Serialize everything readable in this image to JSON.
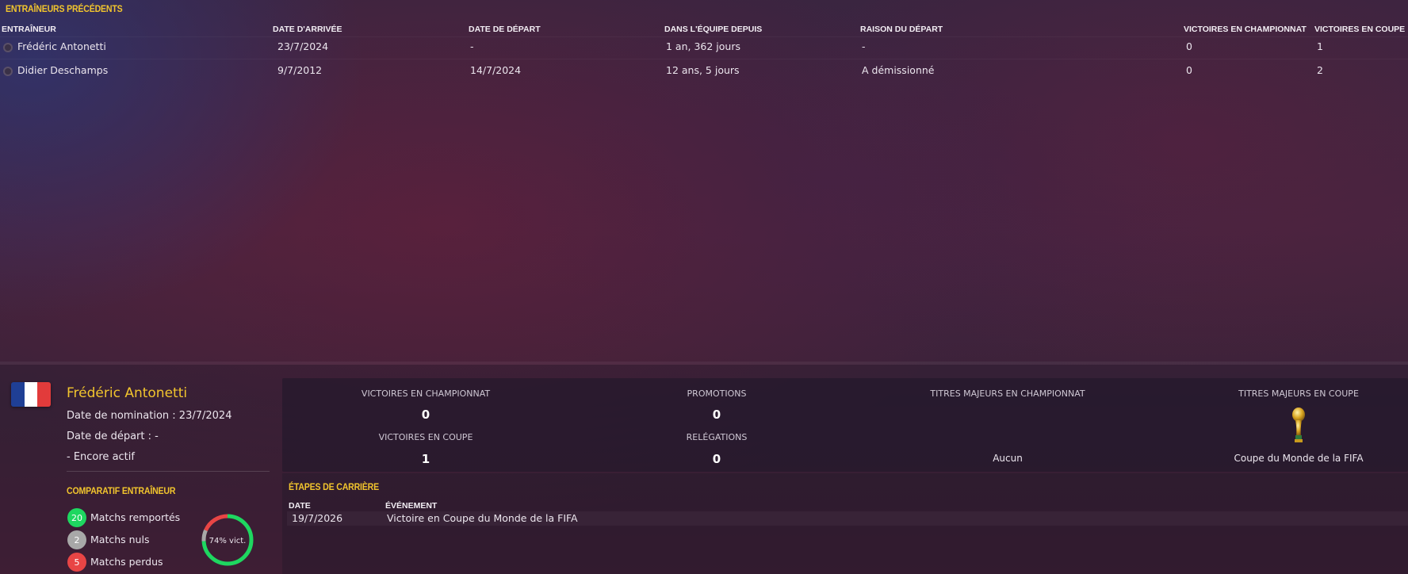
{
  "previous_coaches": {
    "title": "Entraîneurs précédents",
    "columns": [
      "Entraîneur",
      "Date d'arrivée",
      "Date de départ",
      "Dans l'équipe depuis",
      "Raison du départ",
      "Victoires en championnat",
      "Victoires en coupe"
    ],
    "rows": [
      [
        "Frédéric Antonetti",
        "23/7/2024",
        "-",
        "1 an, 362 jours",
        "-",
        "0",
        "1"
      ],
      [
        "Didier Deschamps",
        "9/7/2012",
        "14/7/2024",
        "12 ans, 5 jours",
        "A démissionné",
        "0",
        "2"
      ]
    ]
  },
  "coach_detail": {
    "flag_colors": [
      "#1f3f95",
      "#ffffff",
      "#e23b3b"
    ],
    "name": "Frédéric Antonetti",
    "nomination_label": "Date de nomination : 23/7/2024",
    "departure_label": "Date de départ : -",
    "status_label": "- Encore actif"
  },
  "stats": {
    "league_wins_label": "Victoires en championnat",
    "league_wins": "0",
    "cup_wins_label": "Victoires en coupe",
    "cup_wins": "1",
    "promotions_label": "Promotions",
    "promotions": "0",
    "relegations_label": "Relégations",
    "relegations": "0",
    "major_league_titles_label": "Titres majeurs en championnat",
    "major_league_titles": "Aucun",
    "major_cup_titles_label": "Titres majeurs en coupe",
    "major_cup_title": "Coupe du Monde de la FIFA",
    "trophy_icon": "world-cup-trophy-icon"
  },
  "comparison": {
    "title": "Comparatif entraîneur",
    "won_count": "20",
    "won_label": "Matchs remportés",
    "drawn_count": "2",
    "drawn_label": "Matchs nuls",
    "lost_count": "5",
    "lost_label": "Matchs perdus",
    "win_pct_label": "74% vict.",
    "colors": {
      "won": "#1ed760",
      "drawn": "#a8a8a8",
      "lost": "#e84545"
    }
  },
  "career": {
    "title": "Étapes de carrière",
    "columns": [
      "Date",
      "Événement"
    ],
    "rows": [
      [
        "19/7/2026",
        "Victoire en Coupe du Monde de la FIFA"
      ]
    ]
  }
}
